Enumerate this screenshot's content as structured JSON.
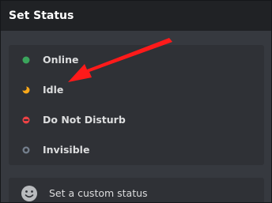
{
  "header": {
    "title": "Set Status"
  },
  "statuses": [
    {
      "label": "Online",
      "icon": "online-dot-icon",
      "color": "#3ba55c"
    },
    {
      "label": "Idle",
      "icon": "idle-moon-icon",
      "color": "#faa81a"
    },
    {
      "label": "Do Not Disturb",
      "icon": "do-not-disturb-icon",
      "color": "#ed4245"
    },
    {
      "label": "Invisible",
      "icon": "invisible-ring-icon",
      "color": "#747f8d"
    }
  ],
  "custom_status": {
    "label": "Set a custom status",
    "icon": "smiley-face-icon"
  },
  "annotation": {
    "icon": "red-arrow-icon",
    "color": "#ff1a1a"
  }
}
